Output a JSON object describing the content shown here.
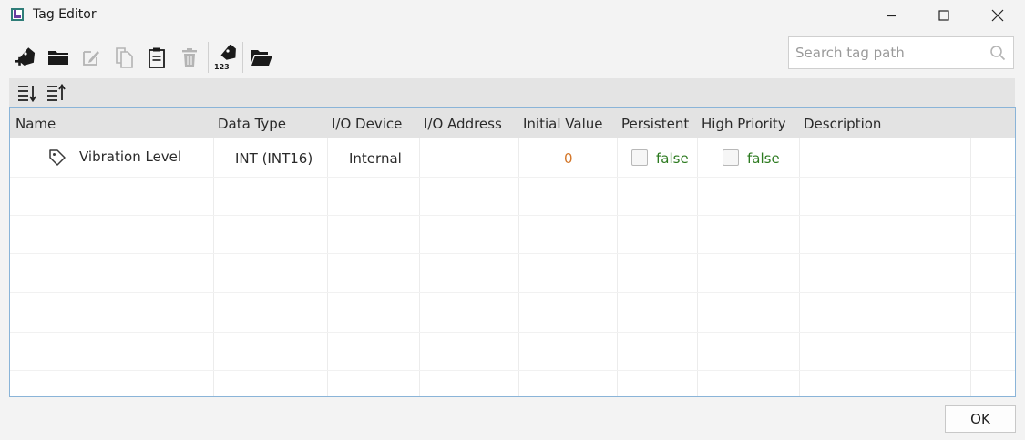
{
  "window": {
    "title": "Tag Editor",
    "icon": "tag-editor-app-icon",
    "controls": [
      "minimize-icon",
      "maximize-icon",
      "close-icon"
    ]
  },
  "toolbar": {
    "buttons": [
      {
        "name": "add-tag",
        "icon": "tag-plus-icon",
        "enabled": true
      },
      {
        "name": "add-folder",
        "icon": "folder-icon",
        "enabled": true
      },
      {
        "name": "edit",
        "icon": "edit-icon",
        "enabled": false
      },
      {
        "name": "copy",
        "icon": "copy-icon",
        "enabled": false
      },
      {
        "name": "paste",
        "icon": "clipboard-icon",
        "enabled": true
      },
      {
        "name": "delete",
        "icon": "trash-icon",
        "enabled": false
      },
      {
        "name": "tag-numeric",
        "icon": "tag-123-icon",
        "enabled": true
      },
      {
        "name": "open-folder",
        "icon": "folder-open-icon",
        "enabled": true
      }
    ],
    "tag_123_label": "123"
  },
  "search": {
    "placeholder": "Search tag path",
    "value": ""
  },
  "sort_buttons": [
    {
      "name": "sort-descending",
      "icon": "sort-descending-icon"
    },
    {
      "name": "sort-ascending",
      "icon": "sort-ascending-icon"
    }
  ],
  "grid": {
    "columns": [
      "Name",
      "Data Type",
      "I/O Device",
      "I/O Address",
      "Initial Value",
      "Persistent",
      "High Priority",
      "Description"
    ],
    "rows": [
      {
        "name": "Vibration Level",
        "data_type": "INT (INT16)",
        "io_device": "Internal",
        "io_address": "",
        "initial_value": "0",
        "persistent": "false",
        "high_priority": "false",
        "description": ""
      }
    ]
  },
  "footer": {
    "ok_label": "OK"
  },
  "colors": {
    "accent_border": "#8ab4d8",
    "boolean_text": "#2c7a1f",
    "initial_value_text": "#d4772a",
    "header_bg": "#e3e3e3"
  }
}
